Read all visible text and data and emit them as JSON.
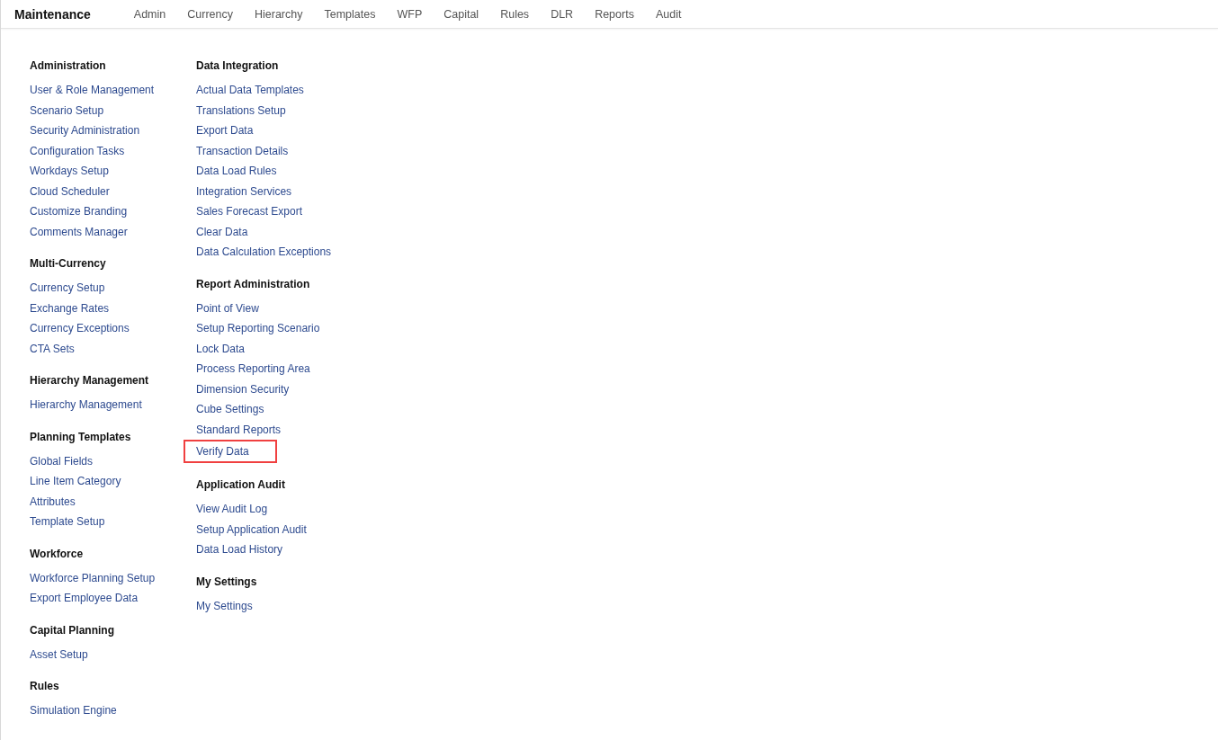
{
  "header": {
    "title": "Maintenance",
    "nav": [
      {
        "label": "Admin"
      },
      {
        "label": "Currency"
      },
      {
        "label": "Hierarchy"
      },
      {
        "label": "Templates"
      },
      {
        "label": "WFP"
      },
      {
        "label": "Capital"
      },
      {
        "label": "Rules"
      },
      {
        "label": "DLR"
      },
      {
        "label": "Reports"
      },
      {
        "label": "Audit"
      }
    ]
  },
  "columns": [
    {
      "sections": [
        {
          "heading": "Administration",
          "items": [
            {
              "label": "User & Role Management",
              "highlighted": false
            },
            {
              "label": "Scenario Setup",
              "highlighted": false
            },
            {
              "label": "Security Administration",
              "highlighted": false
            },
            {
              "label": "Configuration Tasks",
              "highlighted": false
            },
            {
              "label": "Workdays Setup",
              "highlighted": false
            },
            {
              "label": "Cloud Scheduler",
              "highlighted": false
            },
            {
              "label": "Customize Branding",
              "highlighted": false
            },
            {
              "label": "Comments Manager",
              "highlighted": false
            }
          ]
        },
        {
          "heading": "Multi-Currency",
          "items": [
            {
              "label": "Currency Setup",
              "highlighted": false
            },
            {
              "label": "Exchange Rates",
              "highlighted": false
            },
            {
              "label": "Currency Exceptions",
              "highlighted": false
            },
            {
              "label": "CTA Sets",
              "highlighted": false
            }
          ]
        },
        {
          "heading": "Hierarchy Management",
          "items": [
            {
              "label": "Hierarchy Management",
              "highlighted": false
            }
          ]
        },
        {
          "heading": "Planning Templates",
          "items": [
            {
              "label": "Global Fields",
              "highlighted": false
            },
            {
              "label": "Line Item Category",
              "highlighted": false
            },
            {
              "label": "Attributes",
              "highlighted": false
            },
            {
              "label": "Template Setup",
              "highlighted": false
            }
          ]
        },
        {
          "heading": "Workforce",
          "items": [
            {
              "label": "Workforce Planning Setup",
              "highlighted": false
            },
            {
              "label": "Export Employee Data",
              "highlighted": false
            }
          ]
        },
        {
          "heading": "Capital Planning",
          "items": [
            {
              "label": "Asset Setup",
              "highlighted": false
            }
          ]
        },
        {
          "heading": "Rules",
          "items": [
            {
              "label": "Simulation Engine",
              "highlighted": false
            }
          ]
        }
      ]
    },
    {
      "sections": [
        {
          "heading": "Data Integration",
          "items": [
            {
              "label": "Actual Data Templates",
              "highlighted": false
            },
            {
              "label": "Translations Setup",
              "highlighted": false
            },
            {
              "label": "Export Data",
              "highlighted": false
            },
            {
              "label": "Transaction Details",
              "highlighted": false
            },
            {
              "label": "Data Load Rules",
              "highlighted": false
            },
            {
              "label": "Integration Services",
              "highlighted": false
            },
            {
              "label": "Sales Forecast Export",
              "highlighted": false
            },
            {
              "label": "Clear Data",
              "highlighted": false
            },
            {
              "label": "Data Calculation Exceptions",
              "highlighted": false
            }
          ]
        },
        {
          "heading": "Report Administration",
          "items": [
            {
              "label": "Point of View",
              "highlighted": false
            },
            {
              "label": "Setup Reporting Scenario",
              "highlighted": false
            },
            {
              "label": "Lock Data",
              "highlighted": false
            },
            {
              "label": "Process Reporting Area",
              "highlighted": false
            },
            {
              "label": "Dimension Security",
              "highlighted": false
            },
            {
              "label": "Cube Settings",
              "highlighted": false
            },
            {
              "label": "Standard Reports",
              "highlighted": false
            },
            {
              "label": "Verify Data",
              "highlighted": true
            }
          ]
        },
        {
          "heading": "Application Audit",
          "items": [
            {
              "label": "View Audit Log",
              "highlighted": false
            },
            {
              "label": "Setup Application Audit",
              "highlighted": false
            },
            {
              "label": "Data Load History",
              "highlighted": false
            }
          ]
        },
        {
          "heading": "My Settings",
          "items": [
            {
              "label": "My Settings",
              "highlighted": false
            }
          ]
        }
      ]
    }
  ]
}
